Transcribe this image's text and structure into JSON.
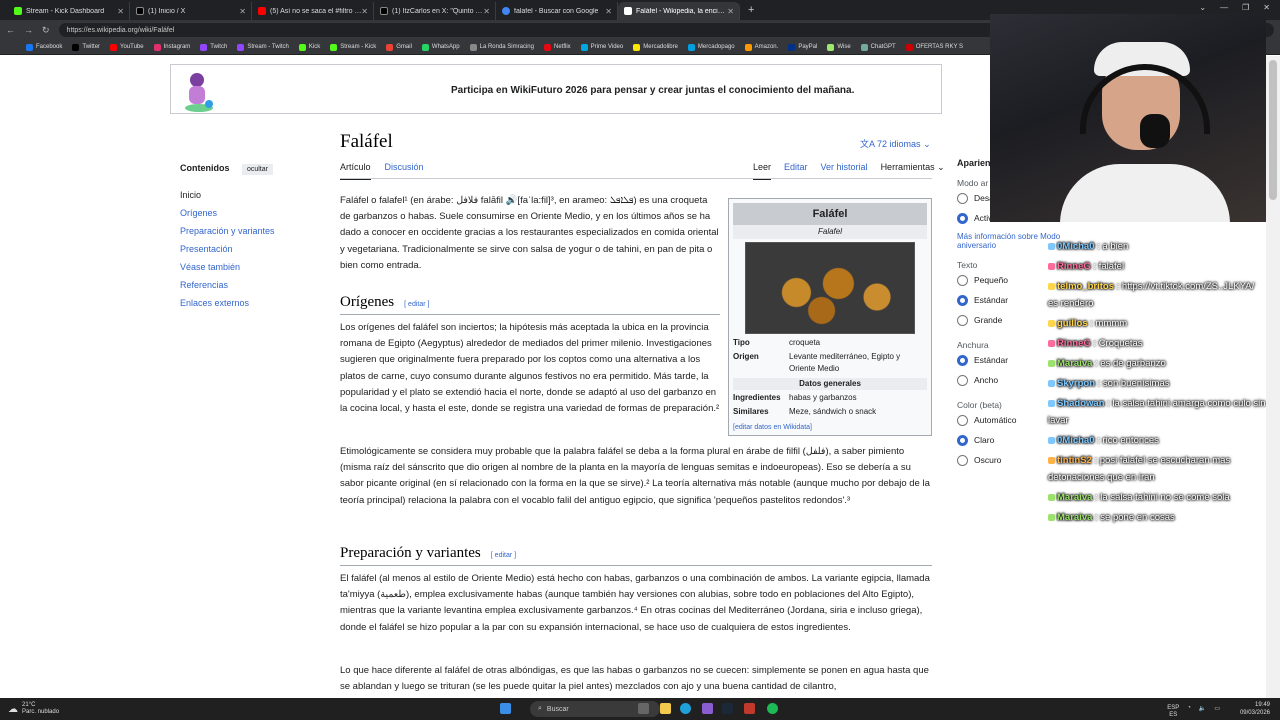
{
  "browser": {
    "tabs": [
      {
        "title": "Stream - Kick Dashboard",
        "color": "#53fc18"
      },
      {
        "title": "(1) Inicio / X",
        "color": "#000000"
      },
      {
        "title": "(5) Así no se saca el #filtro de haba",
        "color": "#ff0000"
      },
      {
        "title": "(1) ItzCarlos en X: \"Quinto comba",
        "color": "#000000"
      },
      {
        "title": "falafel - Buscar con Google",
        "color": "#4285f4"
      },
      {
        "title": "Faláfel - Wikipedia, la enciclopedia",
        "color": "#ffffff"
      }
    ],
    "new_tab": "+",
    "url": "https://es.wikipedia.org/wiki/Faláfel",
    "bookmarks": [
      {
        "label": "Facebook",
        "color": "#1877f2"
      },
      {
        "label": "Twitter",
        "color": "#000000"
      },
      {
        "label": "YouTube",
        "color": "#ff0000"
      },
      {
        "label": "Instagram",
        "color": "#e1306c"
      },
      {
        "label": "Twitch",
        "color": "#9146ff"
      },
      {
        "label": "Stream - Twitch",
        "color": "#9146ff"
      },
      {
        "label": "Kick",
        "color": "#53fc18"
      },
      {
        "label": "Stream - Kick",
        "color": "#53fc18"
      },
      {
        "label": "Gmail",
        "color": "#ea4335"
      },
      {
        "label": "WhatsApp",
        "color": "#25d366"
      },
      {
        "label": "La Ronda Simracing",
        "color": "#888888"
      },
      {
        "label": "Netflix",
        "color": "#e50914"
      },
      {
        "label": "Prime Video",
        "color": "#00a8e1"
      },
      {
        "label": "Mercadolibre",
        "color": "#ffe600"
      },
      {
        "label": "Mercadopago",
        "color": "#009ee3"
      },
      {
        "label": "Amazon.",
        "color": "#ff9900"
      },
      {
        "label": "PayPal",
        "color": "#003087"
      },
      {
        "label": "Wise",
        "color": "#9fe870"
      },
      {
        "label": "ChatGPT",
        "color": "#74aa9c"
      },
      {
        "label": "OFERTAS RKY S",
        "color": "#cc0000"
      }
    ]
  },
  "banner": {
    "text": "Participa en WikiFuturo 2026 para pensar y crear juntas el conocimiento del mañana."
  },
  "toc": {
    "title": "Contenidos",
    "hide": "ocultar",
    "items": [
      "Inicio",
      "Orígenes",
      "Preparación y variantes",
      "Presentación",
      "Véase también",
      "Referencias",
      "Enlaces externos"
    ]
  },
  "article": {
    "title": "Faláfel",
    "languages": "72 idiomas",
    "tabs_left": [
      "Artículo",
      "Discusión"
    ],
    "tabs_right": [
      "Leer",
      "Editar",
      "Ver historial",
      "Herramientas"
    ],
    "intro": "Faláfel o falafel¹ (en árabe: فلافل falāfil 🔊[faˈla:fil]³, en arameo: ܦܠܐܦܠ) es una croqueta de garbanzos o habas. Suele consumirse en Oriente Medio, y en los últimos años se ha dado a conocer en occidente gracias a los restaurantes especializados en comida oriental y vegetariana. Tradicionalmente se sirve con salsa de yogur o de tahini, en pan de pita o bien como entrada.",
    "h_origins": "Orígenes",
    "edit": "editar",
    "origins_p1": "Los orígenes del faláfel son inciertos; la hipótesis más aceptada la ubica en la provincia romana de Egipto (Aegyptus) alrededor de mediados del primer milenio. Investigaciones sugieren que originalmente fuera preparado por los coptos como una alternativa a los platos de carne, cuyo consumo durante algunos festivos no era permitido. Más tarde, la popularidad y el plato se extendió hacia el norte, donde se adaptó al uso del garbanzo en la cocina local, y hasta el este, donde se registra una variedad de formas de preparación.²",
    "origins_p2": "Etimológicamente se considera muy probable que la palabra faláfel se deba a la forma plural en árabe de filfil (فلفل), a saber pimiento (misma raíz del sánscrito que dio origen al nombre de la planta en la mayoría de lenguas semitas e indoeuropeas). Eso se debería a su sabor picante original (en sí relacionado con la forma en la que se sirve).² La teoría alternativa más notable (aunque mucho por debajo de la teoría principal) relaciona la palabra con el vocablo falil del antiguo egipcio, que significa 'pequeños pastelitos redondos'.³",
    "h_prep": "Preparación y variantes",
    "prep_p1": "El faláfel (al menos al estilo de Oriente Medio) está hecho con habas, garbanzos o una combinación de ambos. La variante egipcia, llamada ta'miyya (طعمية), emplea exclusivamente habas (aunque también hay versiones con alubias, sobre todo en poblaciones del Alto Egipto), mientras que la variante levantina emplea exclusivamente garbanzos.⁴ En otras cocinas del Mediterráneo (Jordana, siria e incluso griega), donde el faláfel se hizo popular a la par con su expansión internacional, se hace uso de cualquiera de estos ingredientes.",
    "prep_p2": "Lo que hace diferente al faláfel de otras albóndigas, es que las habas o garbanzos no se cuecen: simplemente se ponen en agua hasta que se ablandan y luego se trituran (se les puede quitar la piel antes) mezclados con ajo y una buena cantidad de cilantro,"
  },
  "infobox": {
    "title": "Faláfel",
    "subtitle": "Falafel",
    "tipo_label": "Tipo",
    "tipo": "croqueta",
    "origen_label": "Origen",
    "origen": "Levante mediterráneo, Egipto y Oriente Medio",
    "general": "Datos generales",
    "ingr_label": "Ingredientes",
    "ingr": "habas y garbanzos",
    "sim_label": "Similares",
    "sim": "Meze, sándwich o snack",
    "edit": "[editar datos en Wikidata]"
  },
  "appearance": {
    "title": "Aparien",
    "modo": "Modo ar",
    "modo_opts": [
      {
        "label": "Desa",
        "on": false
      },
      {
        "label": "Activado",
        "on": true
      }
    ],
    "more": "Más información sobre Modo aniversario",
    "texto": "Texto",
    "texto_opts": [
      {
        "label": "Pequeño",
        "on": false
      },
      {
        "label": "Estándar",
        "on": true
      },
      {
        "label": "Grande",
        "on": false
      }
    ],
    "anchura": "Anchura",
    "anchura_opts": [
      {
        "label": "Estándar",
        "on": true
      },
      {
        "label": "Ancho",
        "on": false
      }
    ],
    "color": "Color (beta)",
    "color_opts": [
      {
        "label": "Automático",
        "on": false
      },
      {
        "label": "Claro",
        "on": true
      },
      {
        "label": "Oscuro",
        "on": false
      }
    ]
  },
  "chat": [
    {
      "user": "0Micha0",
      "color": "#7ec8ff",
      "text": ": a bien"
    },
    {
      "user": "RinneG",
      "color": "#ff6b9a",
      "text": ": falafel"
    },
    {
      "user": "telmo_britos",
      "color": "#ffd54a",
      "text": ": https://vt.tiktok.com/ZS..JLKYA/ es rendero"
    },
    {
      "user": "guillos",
      "color": "#ffd54a",
      "text": ": mmmm"
    },
    {
      "user": "RinneG",
      "color": "#ff6b9a",
      "text": ": Croquetas"
    },
    {
      "user": "Maraiva",
      "color": "#9be36b",
      "text": ": es de garbanzo"
    },
    {
      "user": "Skyrpon",
      "color": "#7ec8ff",
      "text": ": son buenísimas"
    },
    {
      "user": "Shadowan",
      "color": "#7ec8ff",
      "text": ": la salsa tahini amarga como culo sin lavar"
    },
    {
      "user": "0Micha0",
      "color": "#7ec8ff",
      "text": ": rico entonces"
    },
    {
      "user": "tintinS2",
      "color": "#ffb347",
      "text": ": posi falafel se escucharan mas detonaciones que en iran"
    },
    {
      "user": "Maraiva",
      "color": "#9be36b",
      "text": ": la salsa tahini no se come sola"
    },
    {
      "user": "Maraiva",
      "color": "#9be36b",
      "text": ": se pone en cosas"
    }
  ],
  "taskbar": {
    "weather_temp": "21°C",
    "weather_desc": "Parc. nublado",
    "search": "Buscar",
    "lang": "ESP",
    "lang2": "ES",
    "time": "19:49",
    "date": "09/03/2026"
  }
}
